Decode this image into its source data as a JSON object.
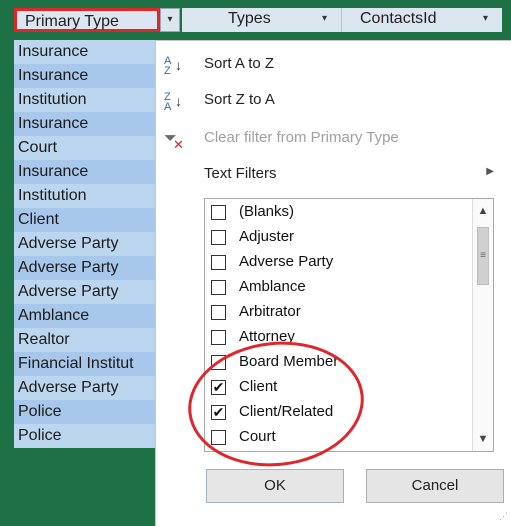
{
  "header": {
    "primary_type": "Primary Type",
    "types": "Types",
    "contacts_id": "ContactsId",
    "dropdown_glyph": "▾"
  },
  "left_column": [
    "Insurance",
    "Insurance",
    "Institution",
    "Insurance",
    "Court",
    "Insurance",
    "Institution",
    "Client",
    "Adverse Party",
    "Adverse Party",
    "Adverse Party",
    "Amblance",
    "Realtor",
    "Financial Institut",
    "Adverse Party",
    "Police",
    "Police"
  ],
  "menu": {
    "sort_az": "Sort A to Z",
    "sort_za": "Sort Z to A",
    "clear_filter": "Clear filter from Primary Type",
    "text_filters": "Text Filters"
  },
  "filter_list": [
    {
      "label": "(Blanks)",
      "checked": false
    },
    {
      "label": "Adjuster",
      "checked": false
    },
    {
      "label": "Adverse Party",
      "checked": false
    },
    {
      "label": "Amblance",
      "checked": false
    },
    {
      "label": "Arbitrator",
      "checked": false
    },
    {
      "label": "Attorney",
      "checked": false
    },
    {
      "label": "Board Member",
      "checked": false
    },
    {
      "label": "Client",
      "checked": true
    },
    {
      "label": "Client/Related",
      "checked": true
    },
    {
      "label": "Court",
      "checked": false
    }
  ],
  "buttons": {
    "ok": "OK",
    "cancel": "Cancel"
  },
  "colors": {
    "highlight_red": "#e0262b",
    "excel_green": "#1e7145"
  }
}
